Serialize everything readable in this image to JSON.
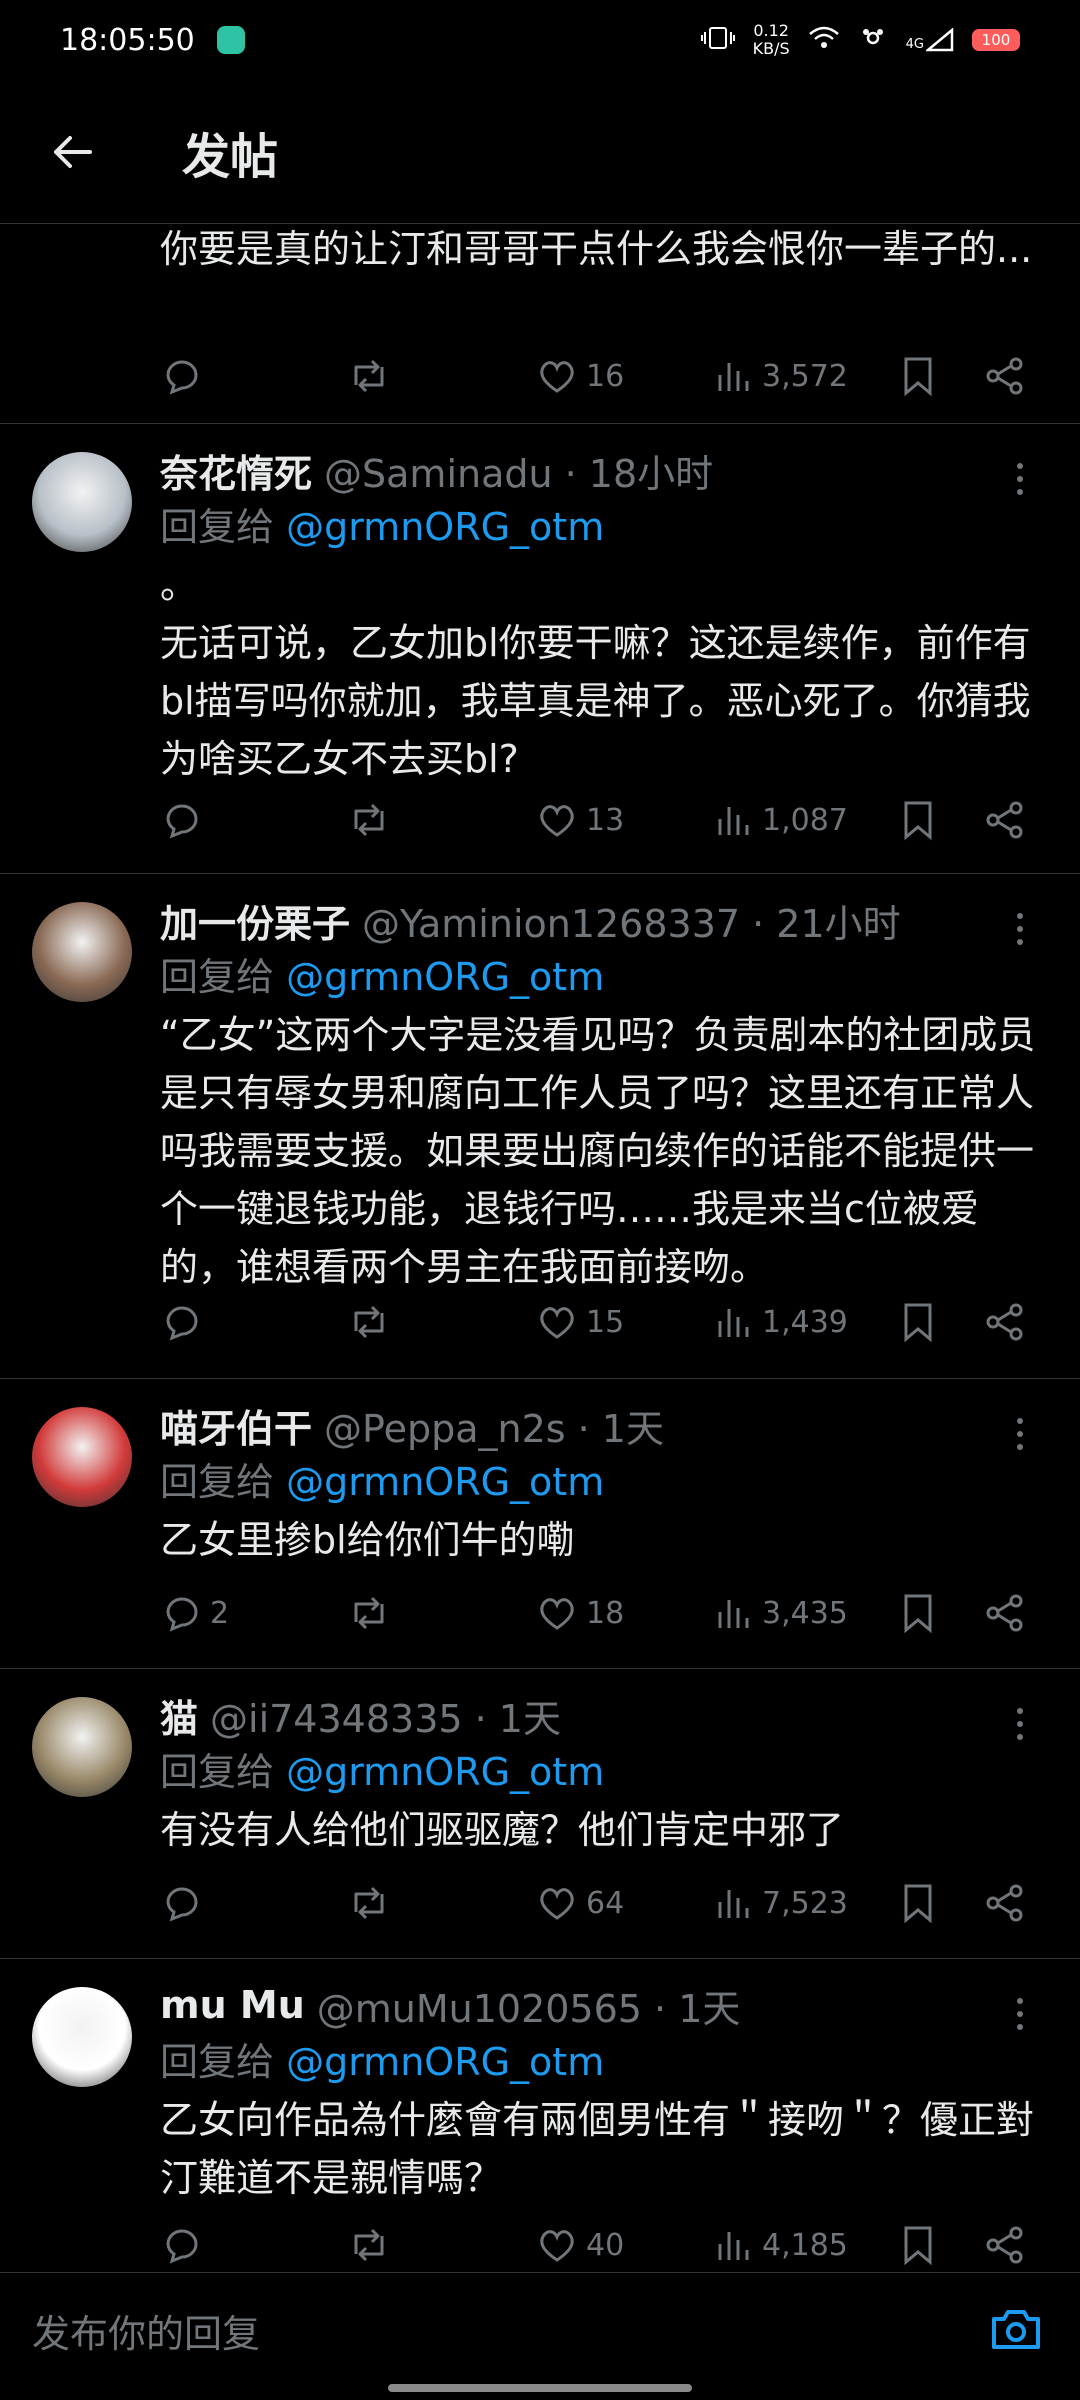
{
  "status_bar": {
    "time": "18:05:50",
    "net_speed_value": "0.12",
    "net_speed_unit": "KB/S",
    "network": "4G",
    "battery": "100"
  },
  "header": {
    "title": "发帖"
  },
  "first_fragment": {
    "text": "你要是真的让汀和哥哥干点什么我会恨你一辈子的...",
    "likes": "16",
    "views": "3,572"
  },
  "posts": [
    {
      "author": "奈花惰死",
      "handle": "@Saminadu · 18小时",
      "reply_prefix": "回复给",
      "reply_mention": "@grmnORG_otm",
      "content": "。\n无话可说，乙女加bl你要干嘛？这还是续作，前作有bl描写吗你就加，我草真是神了。恶心死了。你猜我为啥买乙女不去买bl?",
      "replies": "",
      "likes": "13",
      "views": "1,087",
      "avatar_color": "#b8c0c8"
    },
    {
      "author": "加一份栗子",
      "handle": "@Yaminion1268337 · 21小时",
      "reply_prefix": "回复给",
      "reply_mention": "@grmnORG_otm",
      "content": "“乙女”这两个大字是没看见吗？负责剧本的社团成员是只有辱女男和腐向工作人员了吗？这里还有正常人吗我需要支援。如果要出腐向续作的话能不能提供一个一键退钱功能，退钱行吗……我是来当c位被爱的，谁想看两个男主在我面前接吻。",
      "replies": "",
      "likes": "15",
      "views": "1,439",
      "avatar_color": "#8a6a55"
    },
    {
      "author": "喵牙伯干",
      "handle": "@Peppa_n2s · 1天",
      "reply_prefix": "回复给",
      "reply_mention": "@grmnORG_otm",
      "content": "乙女里掺bl给你们牛的嘞",
      "replies": "2",
      "likes": "18",
      "views": "3,435",
      "avatar_color": "#d23a3a"
    },
    {
      "author": "猫",
      "handle": "@ii74348335 · 1天",
      "reply_prefix": "回复给",
      "reply_mention": "@grmnORG_otm",
      "content": "有没有人给他们驱驱魔？他们肯定中邪了",
      "replies": "",
      "likes": "64",
      "views": "7,523",
      "avatar_color": "#9a8a6a"
    },
    {
      "author": "mu Mu",
      "handle": "@muMu1020565 · 1天",
      "reply_prefix": "回复给",
      "reply_mention": "@grmnORG_otm",
      "content": "乙女向作品為什麼會有兩個男性有＂接吻＂？優正對汀難道不是親情嗎？",
      "replies": "",
      "likes": "40",
      "views": "4,185",
      "avatar_color": "#ffffff"
    }
  ],
  "composer": {
    "placeholder": "发布你的回复"
  },
  "colors": {
    "background": "#000000",
    "text": "#e7e9ea",
    "muted": "#71767b",
    "accent": "#1d9bf0",
    "divider": "#2f3336"
  },
  "icons": [
    "back-arrow-icon",
    "reply-icon",
    "retweet-icon",
    "like-icon",
    "views-icon",
    "bookmark-icon",
    "share-icon",
    "more-icon",
    "camera-icon"
  ]
}
